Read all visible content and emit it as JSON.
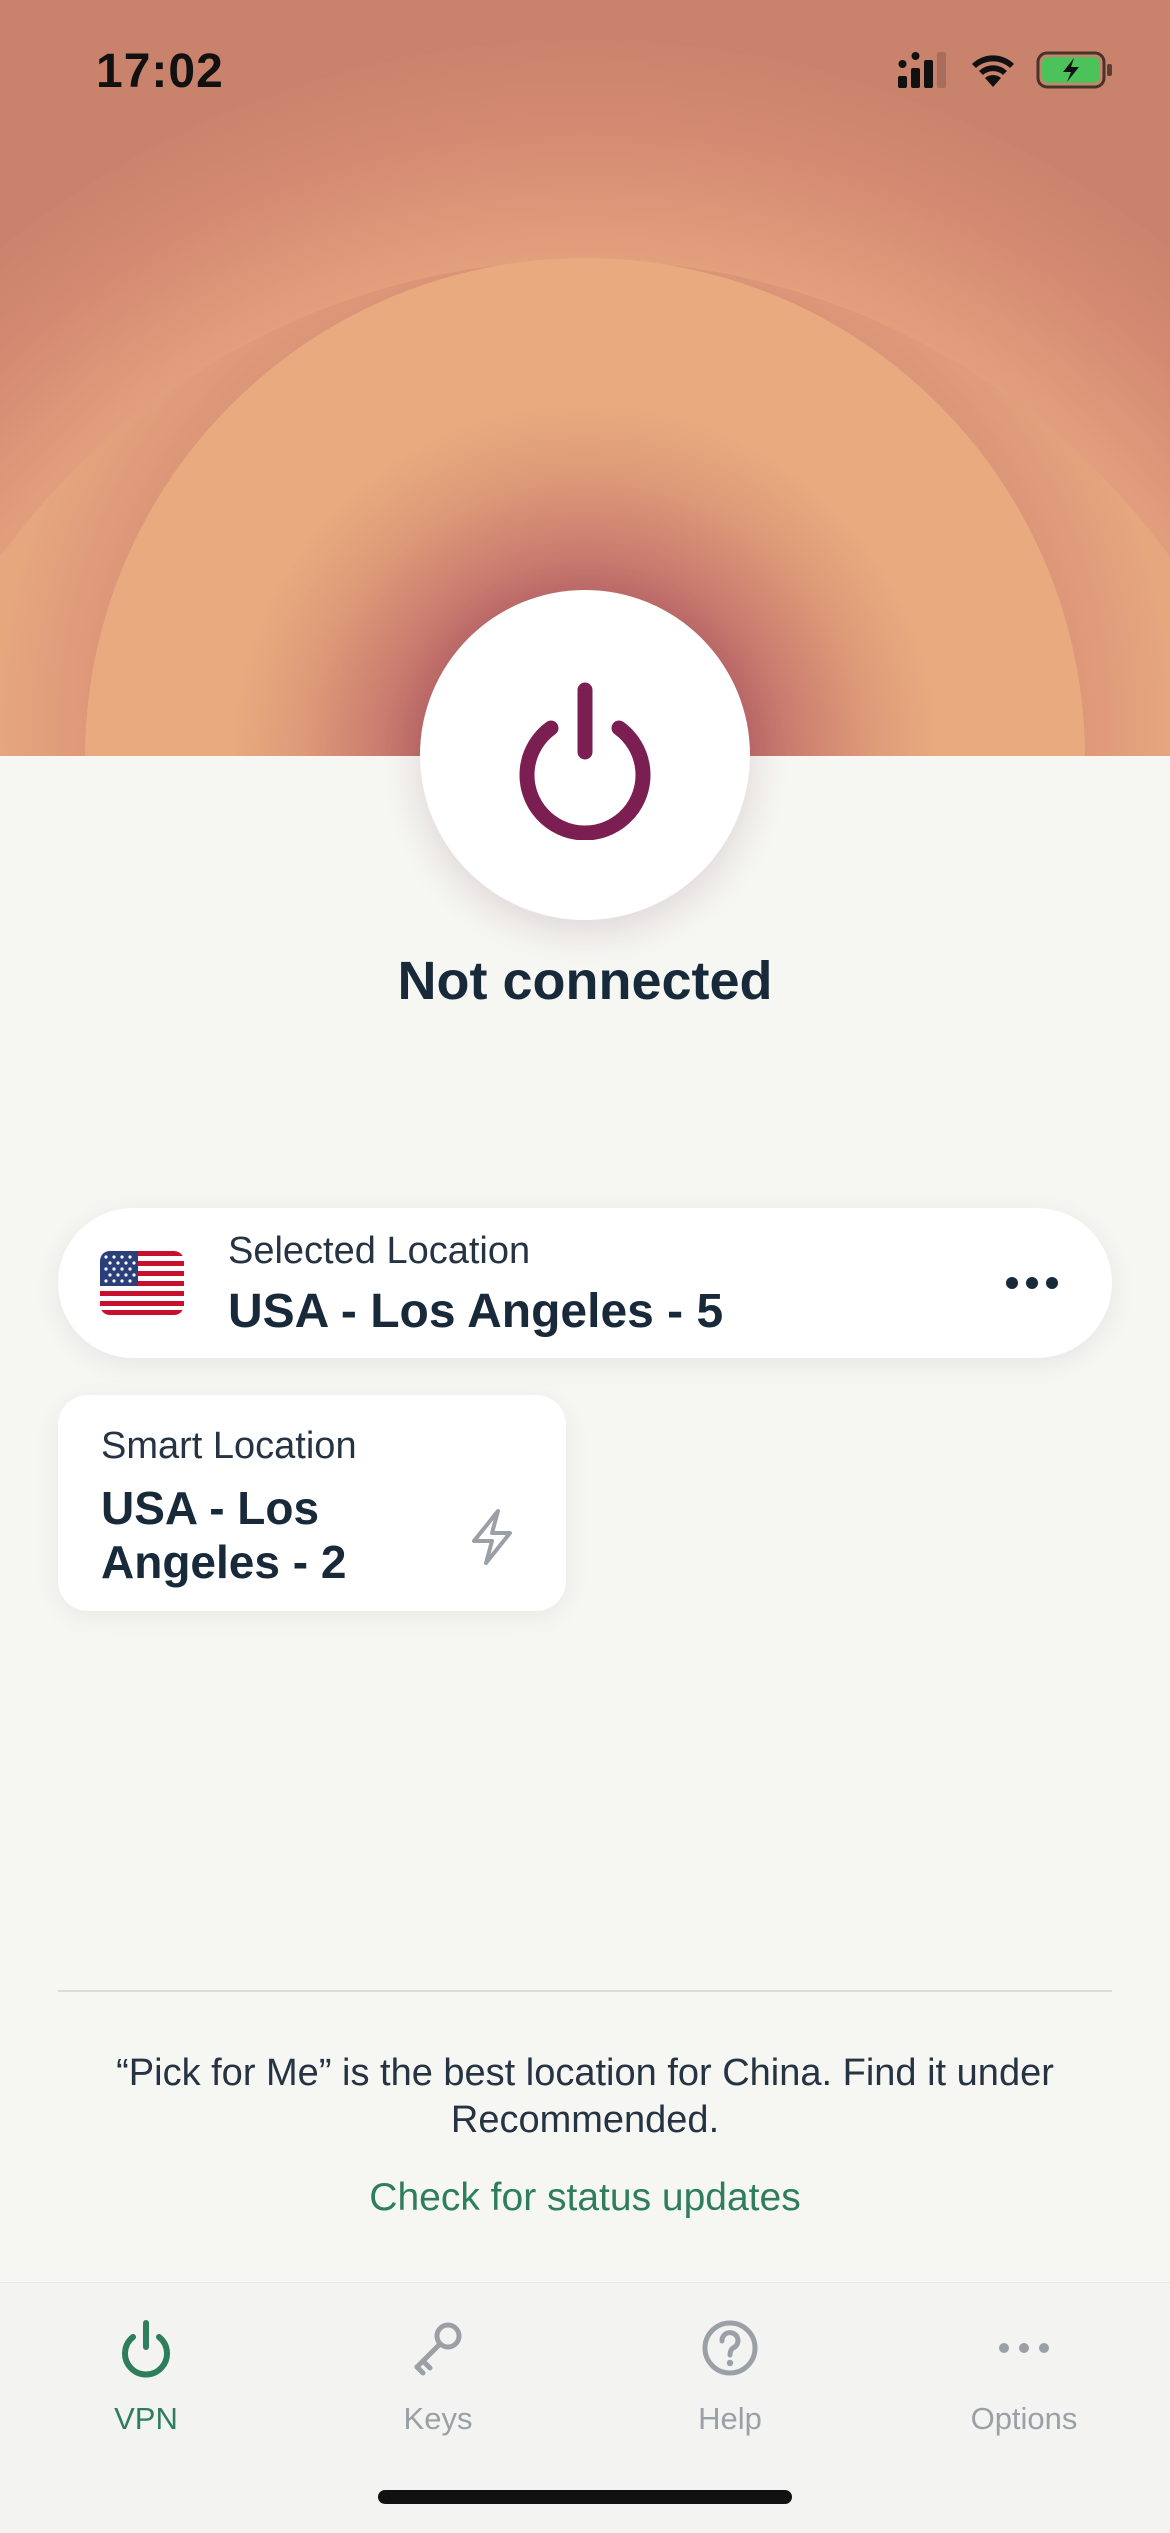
{
  "status_bar": {
    "time": "17:02",
    "battery_state": "charging"
  },
  "connection": {
    "status": "Not connected"
  },
  "selected_location": {
    "label": "Selected Location",
    "value": "USA - Los Angeles - 5",
    "flag": "us-flag"
  },
  "smart_location": {
    "label": "Smart Location",
    "value": "USA - Los Angeles - 2"
  },
  "notice": {
    "text": "“Pick for Me” is the best location for China. Find it under Recommended.",
    "link": "Check for status updates"
  },
  "tabs": [
    {
      "label": "VPN",
      "icon": "power-icon",
      "active": true
    },
    {
      "label": "Keys",
      "icon": "key-icon",
      "active": false
    },
    {
      "label": "Help",
      "icon": "help-icon",
      "active": false
    },
    {
      "label": "Options",
      "icon": "more-icon",
      "active": false
    }
  ],
  "colors": {
    "accent": "#2e7d5b",
    "power": "#7b1e52",
    "text": "#18293a",
    "background": "#f6f6f2",
    "hero": "#e6a47f"
  }
}
